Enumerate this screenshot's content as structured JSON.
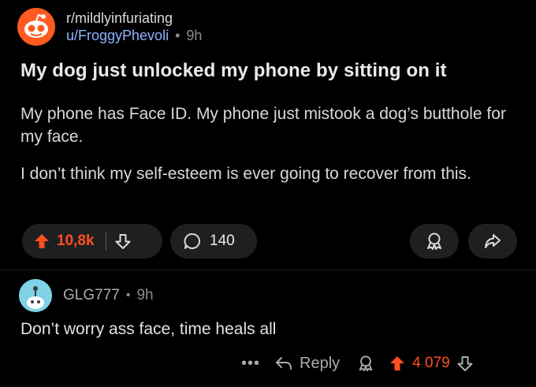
{
  "post": {
    "subreddit": "r/mildlyinfuriating",
    "author": "u/FroggyPhevoli",
    "separator": "•",
    "time": "9h",
    "title": "My dog just unlocked my phone by sitting on it",
    "body": [
      "My phone has Face ID. My phone just mistook a dog’s butthole for my face.",
      "I don’t think my self-esteem is ever going to recover from this."
    ],
    "votes": "10,8k",
    "comments": "140"
  },
  "comment": {
    "author": "GLG777",
    "separator": "•",
    "time": "9h",
    "text": "Don’t worry ass face, time heals all",
    "more": "•••",
    "reply_label": "Reply",
    "votes": "4 079"
  },
  "colors": {
    "background": "#000000",
    "upvote": "#ff4f1f",
    "username": "#8fb3ff",
    "pill": "#1e1f21",
    "subreddit_avatar": "#ff5a1f",
    "user_avatar": "#7ed3e8"
  },
  "icons": {
    "subreddit_avatar": "snoo-avatar-icon",
    "upvote": "upvote-arrow-icon",
    "downvote": "downvote-arrow-icon",
    "comment": "speech-bubble-icon",
    "award": "award-icon",
    "share": "share-arrow-icon",
    "reply": "reply-arrow-icon",
    "user_avatar": "snoo-user-avatar-icon"
  }
}
